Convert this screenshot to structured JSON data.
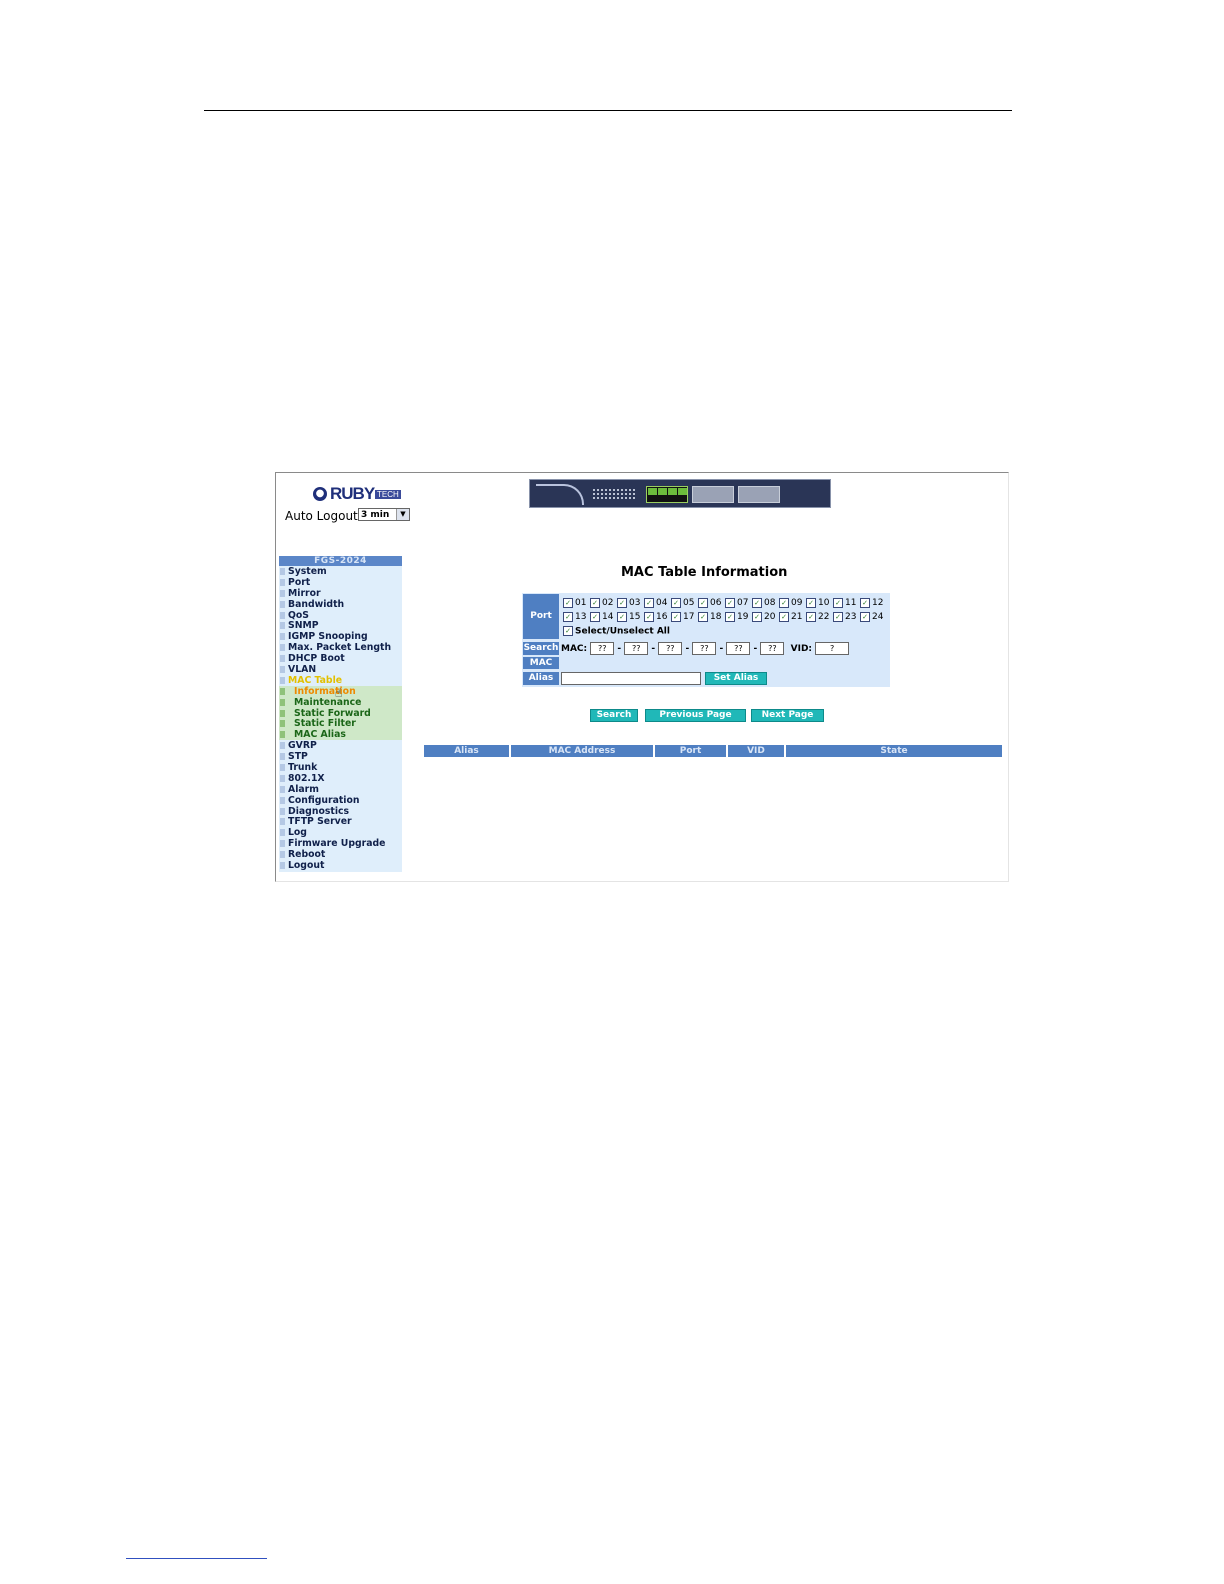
{
  "app": {
    "logo_text": "RUBY",
    "logo_suffix": "TECH",
    "auto_logout_label": "Auto Logout",
    "auto_logout_value": "3 min"
  },
  "menu": {
    "title": "FGS-2024",
    "items": [
      "System",
      "Port",
      "Mirror",
      "Bandwidth",
      "QoS",
      "SNMP",
      "IGMP Snooping",
      "Max. Packet Length",
      "DHCP Boot",
      "VLAN",
      "MAC Table"
    ],
    "submenu": [
      "Information",
      "Maintenance",
      "Static Forward",
      "Static Filter",
      "MAC Alias"
    ],
    "items_after": [
      "GVRP",
      "STP",
      "Trunk",
      "802.1X",
      "Alarm",
      "Configuration",
      "Diagnostics",
      "TFTP Server",
      "Log",
      "Firmware Upgrade",
      "Reboot",
      "Logout"
    ]
  },
  "main": {
    "title": "MAC Table Information",
    "port_label": "Port",
    "ports_row1": [
      "01",
      "02",
      "03",
      "04",
      "05",
      "06",
      "07",
      "08",
      "09",
      "10",
      "11",
      "12"
    ],
    "ports_row2": [
      "13",
      "14",
      "15",
      "16",
      "17",
      "18",
      "19",
      "20",
      "21",
      "22",
      "23",
      "24"
    ],
    "select_all_label": "Select/Unselect All",
    "search_label": "Search",
    "mac_label": "MAC",
    "alias_label": "Alias",
    "mac_field_label": "MAC:",
    "mac_placeholder": "??",
    "vid_label": "VID:",
    "vid_placeholder": "?",
    "set_alias_button": "Set Alias",
    "search_button": "Search",
    "previous_button": "Previous Page",
    "next_button": "Next Page"
  },
  "table": {
    "headers": [
      "Alias",
      "MAC Address",
      "Port",
      "VID",
      "State"
    ]
  }
}
